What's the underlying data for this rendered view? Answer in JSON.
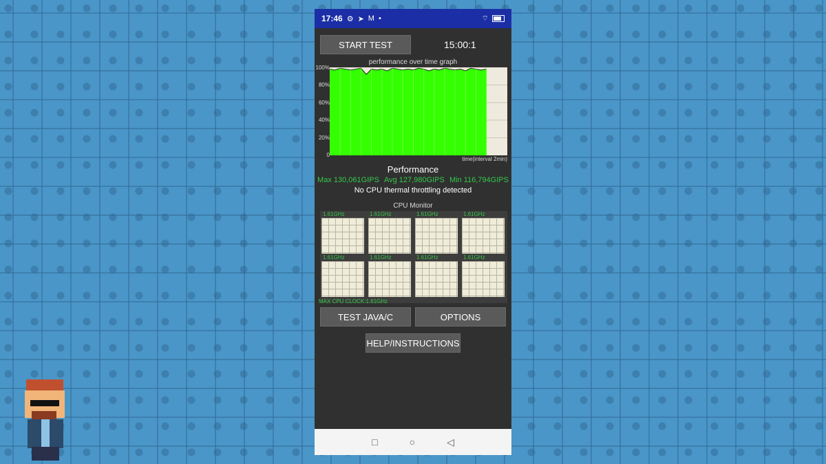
{
  "status_bar": {
    "time": "17:46",
    "icons": [
      "gear-icon",
      "telegram-icon",
      "gmail-icon",
      "dot-icon"
    ],
    "right_icons": [
      "wifi-icon",
      "battery-icon"
    ]
  },
  "controls": {
    "start_test_label": "START TEST",
    "timer": "15:00:1"
  },
  "performance_graph": {
    "title": "performance over time graph",
    "y_ticks": [
      "100%",
      "80%",
      "60%",
      "40%",
      "20%",
      "0"
    ],
    "x_label": "time(interval 2min)",
    "fill_color": "#33ff00"
  },
  "chart_data": {
    "type": "area",
    "title": "performance over time graph",
    "xlabel": "time(interval 2min)",
    "ylabel": "",
    "ylim": [
      0,
      100
    ],
    "grid": true,
    "x": [
      0,
      0.5,
      1,
      1.5,
      2,
      2.5,
      3,
      3.5,
      4,
      4.5,
      5,
      5.5,
      6,
      6.5,
      7,
      7.5,
      8,
      8.5,
      9,
      9.5,
      10,
      10.5,
      11,
      11.5,
      12,
      12.5,
      13,
      13.5,
      14,
      14.5,
      15
    ],
    "values": [
      98,
      97,
      99,
      98,
      97,
      98,
      99,
      92,
      98,
      97,
      98,
      96,
      99,
      98,
      97,
      98,
      97,
      99,
      98,
      96,
      98,
      97,
      99,
      98,
      97,
      98,
      96,
      99,
      98,
      97,
      98
    ],
    "x_end": 17
  },
  "performance": {
    "heading": "Performance",
    "max": "Max 130,061GIPS",
    "avg": "Avg 127,980GIPS",
    "min": "Min 116,794GIPS",
    "throttling": "No CPU thermal throttling detected"
  },
  "cpu_monitor": {
    "title": "CPU Monitor",
    "cores": [
      "1.61GHz",
      "1.61GHz",
      "1.61GHz",
      "1.61GHz",
      "1.61GHz",
      "1.61GHz",
      "1.61GHz",
      "1.61GHz"
    ],
    "max_clock": "MAX CPU CLOCK:1.61GHz"
  },
  "buttons": {
    "test_java": "TEST JAVA/C",
    "options": "OPTIONS",
    "help": "HELP/INSTRUCTIONS"
  },
  "nav": {
    "recent": "□",
    "home": "○",
    "back": "◁"
  },
  "colors": {
    "status_bar": "#1b2ea6",
    "app_bg": "#303030",
    "accent_green": "#35c84a"
  }
}
